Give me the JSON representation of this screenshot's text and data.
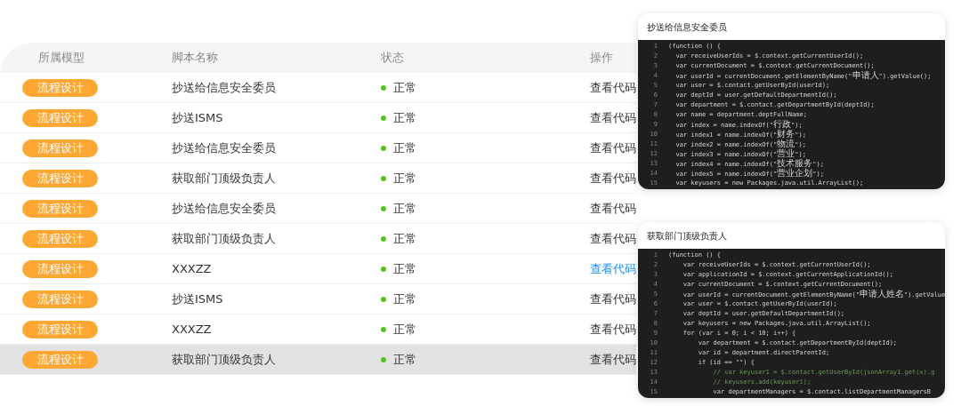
{
  "table": {
    "columns": [
      "所属模型",
      "脚本名称",
      "状态",
      "操作"
    ],
    "rows": [
      {
        "model": "流程设计",
        "name": "抄送给信息安全委员",
        "status": "正常",
        "action": "查看代码",
        "action_active": false,
        "highlighted": false
      },
      {
        "model": "流程设计",
        "name": "抄送ISMS",
        "status": "正常",
        "action": "查看代码",
        "action_active": false,
        "highlighted": false
      },
      {
        "model": "流程设计",
        "name": "抄送给信息安全委员",
        "status": "正常",
        "action": "查看代码",
        "action_active": false,
        "highlighted": false
      },
      {
        "model": "流程设计",
        "name": "获取部门顶级负责人",
        "status": "正常",
        "action": "查看代码",
        "action_active": false,
        "highlighted": false
      },
      {
        "model": "流程设计",
        "name": "抄送给信息安全委员",
        "status": "正常",
        "action": "查看代码",
        "action_active": false,
        "highlighted": false
      },
      {
        "model": "流程设计",
        "name": "获取部门顶级负责人",
        "status": "正常",
        "action": "查看代码",
        "action_active": false,
        "highlighted": false
      },
      {
        "model": "流程设计",
        "name": "XXXZZ",
        "status": "正常",
        "action": "查看代码",
        "action_active": true,
        "highlighted": false
      },
      {
        "model": "流程设计",
        "name": "抄送ISMS",
        "status": "正常",
        "action": "查看代码",
        "action_active": false,
        "highlighted": false
      },
      {
        "model": "流程设计",
        "name": "XXXZZ",
        "status": "正常",
        "action": "查看代码",
        "action_active": false,
        "highlighted": false
      },
      {
        "model": "流程设计",
        "name": "获取部门顶级负责人",
        "status": "正常",
        "action": "查看代码",
        "action_active": false,
        "highlighted": true
      }
    ]
  },
  "code_panels": [
    {
      "title": "抄送给信息安全委员",
      "lines": [
        {
          "number": "1",
          "text": "(function () {",
          "kind": "code"
        },
        {
          "number": "2",
          "text": "  var receiveUserIds = $.context.getCurrentUserId();",
          "kind": "code"
        },
        {
          "number": "3",
          "text": "  var currentDocument = $.context.getCurrentDocument();",
          "kind": "code"
        },
        {
          "number": "4",
          "text": "  var userId = currentDocument.getElementByName(\"申请人\").getValue();",
          "kind": "code"
        },
        {
          "number": "5",
          "text": "  var user = $.contact.getUserById(userId);",
          "kind": "code"
        },
        {
          "number": "6",
          "text": "  var deptId = user.getDefaultDepartmentId();",
          "kind": "code"
        },
        {
          "number": "7",
          "text": "  var department = $.contact.getDepartmentById(deptId);",
          "kind": "code"
        },
        {
          "number": "8",
          "text": "  var name = department.deptFullName;",
          "kind": "code"
        },
        {
          "number": "9",
          "text": "  var index = name.indexOf(\"行政\");",
          "kind": "code"
        },
        {
          "number": "10",
          "text": "  var index1 = name.indexOf(\"财务\");",
          "kind": "code"
        },
        {
          "number": "11",
          "text": "  var index2 = name.indexOf(\"物流\");",
          "kind": "code"
        },
        {
          "number": "12",
          "text": "  var index3 = name.indexOf(\"营业\");",
          "kind": "code"
        },
        {
          "number": "13",
          "text": "  var index4 = name.indexOf(\"技术服务\");",
          "kind": "code"
        },
        {
          "number": "14",
          "text": "  var index5 = name.indexOf(\"营业企划\");",
          "kind": "code"
        },
        {
          "number": "15",
          "text": "  var keyusers = new Packages.java.util.ArrayList();",
          "kind": "code"
        }
      ]
    },
    {
      "title": "获取部门顶级负责人",
      "lines": [
        {
          "number": "1",
          "text": "(function () {",
          "kind": "code"
        },
        {
          "number": "2",
          "text": "    var receiveUserIds = $.context.getCurrentUserId();",
          "kind": "code"
        },
        {
          "number": "3",
          "text": "    var applicationId = $.context.getCurrentApplicationId();",
          "kind": "code"
        },
        {
          "number": "4",
          "text": "    var currentDocument = $.context.getCurrentDocument();",
          "kind": "code"
        },
        {
          "number": "5",
          "text": "    var userId = currentDocument.getElementByName(\"申请人姓名\").getValue",
          "kind": "code"
        },
        {
          "number": "6",
          "text": "    var user = $.contact.getUserById(userId);",
          "kind": "code"
        },
        {
          "number": "7",
          "text": "    var deptId = user.getDefaultDepartmentId();",
          "kind": "code"
        },
        {
          "number": "8",
          "text": "    var keyusers = new Packages.java.util.ArrayList();",
          "kind": "code"
        },
        {
          "number": "9",
          "text": "    for (var i = 0; i < 10; i++) {",
          "kind": "code"
        },
        {
          "number": "10",
          "text": "        var department = $.contact.getDepartmentById(deptId);",
          "kind": "code"
        },
        {
          "number": "11",
          "text": "        var id = department.directParentId;",
          "kind": "code"
        },
        {
          "number": "12",
          "text": "        if (id == \"\") {",
          "kind": "code"
        },
        {
          "number": "13",
          "text": "            // var keyuser1 = $.contact.getUserById(jsonArray1.get(x).g",
          "kind": "comment"
        },
        {
          "number": "14",
          "text": "            // keyusers.add(keyuser1);",
          "kind": "comment"
        },
        {
          "number": "15",
          "text": "            var departmentManagers = $.contact.listDepartmentManagersB",
          "kind": "code"
        }
      ]
    }
  ]
}
